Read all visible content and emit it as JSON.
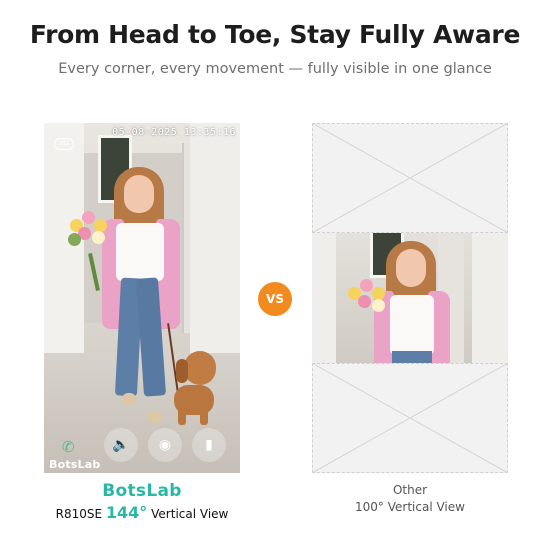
{
  "header": {
    "title": "From Head to Toe, Stay Fully Aware",
    "subtitle": "Every corner, every movement — fully visible in one glance"
  },
  "left_view": {
    "timestamp": "05-08-2025  13:35:16",
    "hd_badge": "HD",
    "watermark": "BotsLab",
    "controls": [
      "phone-icon",
      "speaker-icon",
      "camera-icon",
      "video-icon"
    ]
  },
  "vs_badge": "VS",
  "left_caption": {
    "brand": "BotsLab",
    "model": "R810SE",
    "degrees": "144°",
    "view": "Vertical View"
  },
  "right_caption": {
    "label": "Other",
    "view": "100° Vertical View"
  },
  "colors": {
    "accent": "#2bb7a5",
    "vs": "#f38a1d",
    "cardigan": "#eaa3c6"
  }
}
